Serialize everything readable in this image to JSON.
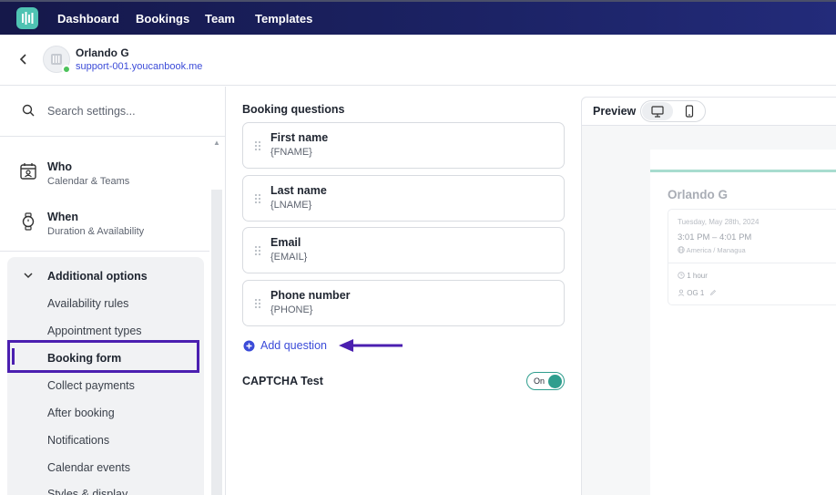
{
  "nav": {
    "items": [
      "Dashboard",
      "Bookings",
      "Team",
      "Templates"
    ]
  },
  "account": {
    "name": "Orlando G",
    "url": "support-001.youcanbook.me"
  },
  "sidebar": {
    "search_placeholder": "Search settings...",
    "main_items": [
      {
        "title": "Who",
        "subtitle": "Calendar & Teams",
        "icon": "calendar-person-icon"
      },
      {
        "title": "When",
        "subtitle": "Duration & Availability",
        "icon": "watch-icon"
      }
    ],
    "options_header": "Additional options",
    "sub_items": [
      "Availability rules",
      "Appointment types",
      "Booking form",
      "Collect payments",
      "After booking",
      "Notifications",
      "Calendar events",
      "Styles & display"
    ],
    "active_item": "Booking form"
  },
  "booking_questions": {
    "title": "Booking questions",
    "questions": [
      {
        "label": "First name",
        "token": "{FNAME}"
      },
      {
        "label": "Last name",
        "token": "{LNAME}"
      },
      {
        "label": "Email",
        "token": "{EMAIL}"
      },
      {
        "label": "Phone number",
        "token": "{PHONE}"
      }
    ],
    "add_label": "Add question",
    "captcha_label": "CAPTCHA Test",
    "captcha_toggle": "On"
  },
  "preview": {
    "title": "Preview",
    "name": "Orlando G",
    "date": "Tuesday, May 28th, 2024",
    "time": "3:01 PM – 4:01 PM",
    "timezone": "America / Managua",
    "duration": "1 hour",
    "staff": "OG 1"
  },
  "colors": {
    "nav_bg": "#1c2366",
    "accent_teal": "#4fc3b3",
    "highlight_purple": "#4b1fb0",
    "link_blue": "#3b4bd8"
  }
}
